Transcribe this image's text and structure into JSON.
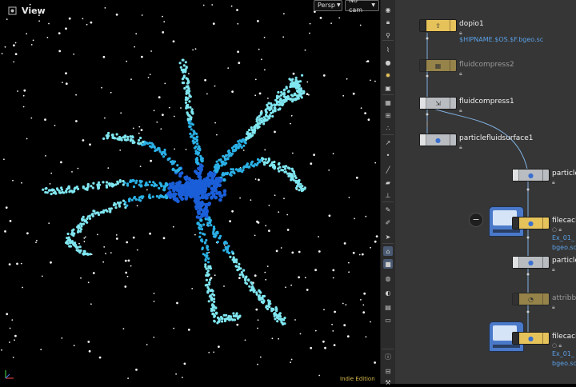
{
  "viewport": {
    "title": "View",
    "camera_mode": "Persp",
    "camera_name": "No cam",
    "watermark": "Indie Edition"
  },
  "colors": {
    "viewport_bg": "#000000",
    "network_bg": "#363636",
    "toolbar_bg": "#2b2b2b",
    "particle_light": "#7fe6f0",
    "particle_mid": "#2ab0e6",
    "particle_core": "#1a5ed8",
    "path_text": "#5aa0e6",
    "node_gold": "#e6c25a",
    "node_grey": "#b9bcc0"
  },
  "toolbar": {
    "icons": [
      "eye-icon",
      "lock-icon",
      "pin-icon",
      "wire-icon",
      "sphere-icon",
      "light-icon",
      "camera-icon",
      "grid-icon",
      "snap-icon",
      "points-icon",
      "normals-icon",
      "vertex-icon",
      "edge-icon",
      "face-icon",
      "ruler-icon",
      "pen-icon",
      "brush-icon",
      "select-icon",
      "wire-display-icon",
      "shaded-icon",
      "ghost-icon",
      "xray-icon",
      "template-icon",
      "display-icon",
      "info-icon",
      "view-layout-icon",
      "tools-icon"
    ]
  },
  "network": {
    "nodes": [
      {
        "name": "dopio1",
        "path": "$HIPNAME.$OS.$F.bgeo.sc",
        "type": "gold",
        "bypassed": false
      },
      {
        "name": "fluidcompress2",
        "path": "",
        "type": "gold",
        "bypassed": true
      },
      {
        "name": "fluidcompress1",
        "path": "",
        "type": "grey",
        "bypassed": false
      },
      {
        "name": "particlefluidsurface1",
        "path": "",
        "type": "grey",
        "bypassed": false
      },
      {
        "name": "particle",
        "path": "",
        "type": "grey",
        "bypassed": false
      },
      {
        "name": "filecach",
        "path": "Ex_01_",
        "path2": "bgeo.sc",
        "type": "gold",
        "bypassed": false
      },
      {
        "name": "particle",
        "path": "",
        "type": "grey",
        "bypassed": false
      },
      {
        "name": "attribb",
        "path": "",
        "type": "gold",
        "bypassed": true
      },
      {
        "name": "filecach",
        "path": "Ex_01_",
        "path2": "bgeo.sc",
        "type": "gold",
        "bypassed": false
      }
    ],
    "collapse_glyph": "−"
  }
}
